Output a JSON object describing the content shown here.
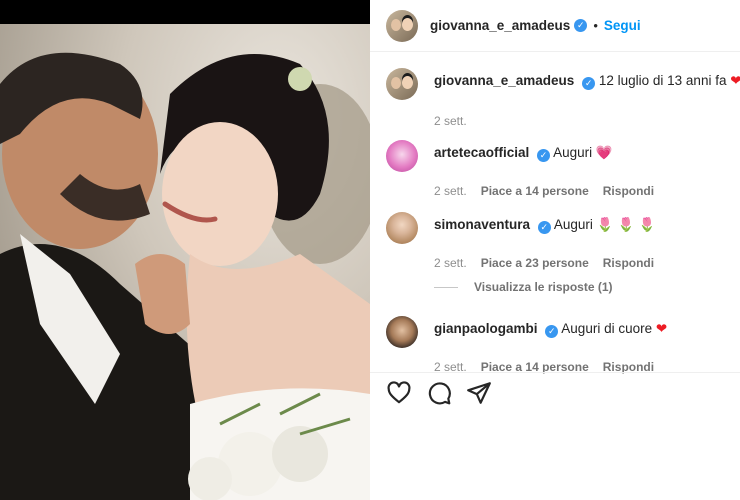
{
  "post": {
    "username": "giovanna_e_amadeus",
    "follow_label": "Segui",
    "separator": "•"
  },
  "caption": {
    "username": "giovanna_e_amadeus",
    "text": "12 luglio di 13 anni fa",
    "time": "2 sett."
  },
  "comments": [
    {
      "username": "artetecaofficial",
      "text": "Auguri",
      "emoji": "💗",
      "time": "2 sett.",
      "likes": "Piace a 14 persone",
      "reply": "Rispondi"
    },
    {
      "username": "simonaventura",
      "text": "Auguri",
      "emoji": "🌷 🌷 🌷",
      "time": "2 sett.",
      "likes": "Piace a 23 persone",
      "reply": "Rispondi"
    },
    {
      "username": "gianpaologambi",
      "text": "Auguri di cuore",
      "emoji": "❤",
      "time": "2 sett.",
      "likes": "Piace a 14 persone",
      "reply": "Rispondi"
    }
  ],
  "view_replies": "Visualizza le risposte (1)",
  "icons": {
    "like": "heart-outline-icon",
    "comment": "speech-bubble-icon",
    "share": "paper-plane-icon",
    "verified": "verified-badge-icon"
  },
  "colors": {
    "accent": "#0095f6",
    "verified": "#3897f0",
    "heart": "#ed1c24"
  }
}
